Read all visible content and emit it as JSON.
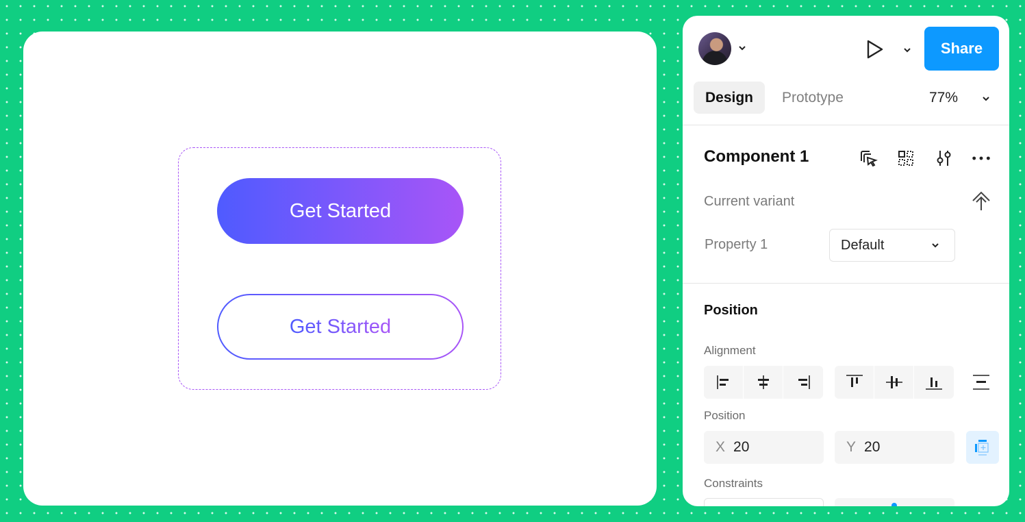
{
  "canvas": {
    "buttons": [
      {
        "label": "Get Started",
        "style": "filled-gradient"
      },
      {
        "label": "Get Started",
        "style": "outline-gradient"
      }
    ],
    "gradient": {
      "start": "#4F5BFF",
      "end": "#A855F7"
    },
    "selection_color": "#A855F7"
  },
  "panel": {
    "header": {
      "avatar_icon": "user-avatar",
      "present_icon": "play-icon",
      "share_label": "Share",
      "share_color": "#0D99FF"
    },
    "tabs": [
      {
        "label": "Design",
        "active": true
      },
      {
        "label": "Prototype",
        "active": false
      }
    ],
    "zoom": "77%",
    "component": {
      "title": "Component 1",
      "icons": [
        "select-matching-icon",
        "component-grid-icon",
        "adjust-icon",
        "more-icon"
      ]
    },
    "current_variant_label": "Current variant",
    "property": {
      "label": "Property 1",
      "value": "Default"
    },
    "position_section": {
      "title": "Position",
      "alignment_label": "Alignment",
      "position_label": "Position",
      "x_axis": "X",
      "x_value": "20",
      "y_axis": "Y",
      "y_value": "20",
      "constraints_label": "Constraints"
    }
  },
  "background_color": "#10CE82"
}
